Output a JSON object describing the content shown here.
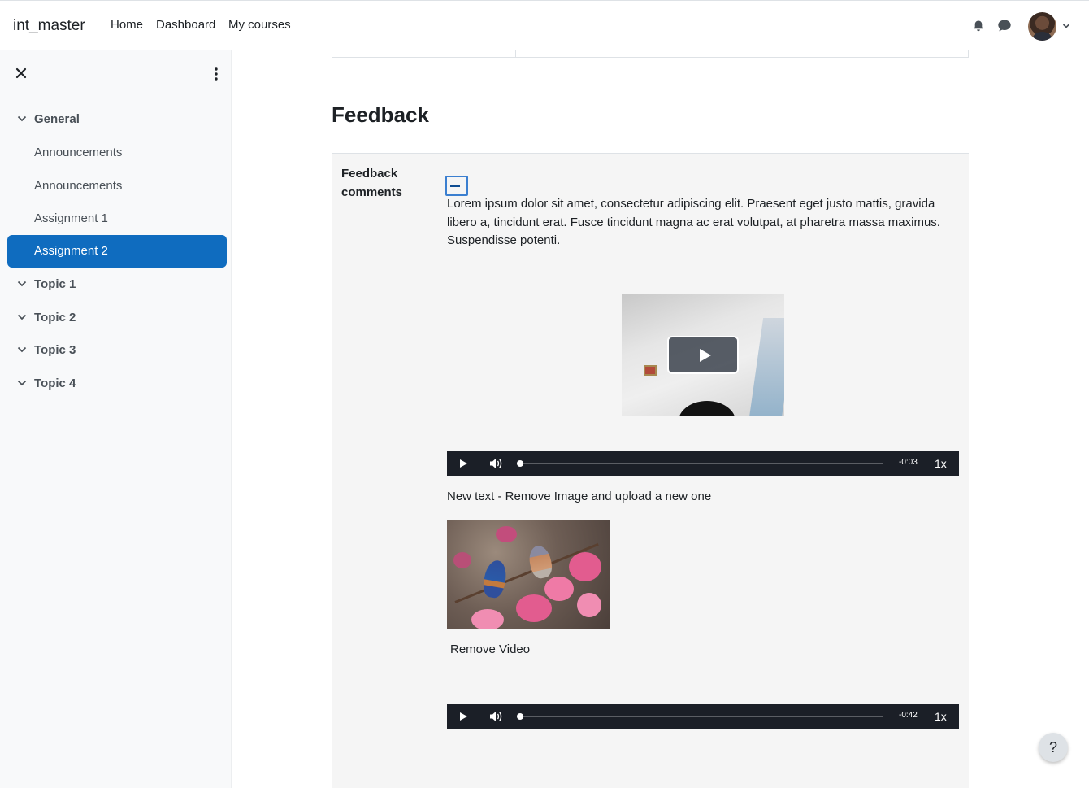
{
  "navbar": {
    "brand": "int_master",
    "links": [
      "Home",
      "Dashboard",
      "My courses"
    ]
  },
  "drawer": {
    "items": [
      {
        "label": "General",
        "type": "section",
        "expanded": true
      },
      {
        "label": "Announcements",
        "type": "activity"
      },
      {
        "label": "Announcements",
        "type": "activity"
      },
      {
        "label": "Assignment 1",
        "type": "activity"
      },
      {
        "label": "Assignment 2",
        "type": "activity",
        "active": true
      },
      {
        "label": "Topic 1",
        "type": "section",
        "expanded": true
      },
      {
        "label": "Topic 2",
        "type": "section",
        "expanded": true
      },
      {
        "label": "Topic 3",
        "type": "section",
        "expanded": true
      },
      {
        "label": "Topic 4",
        "type": "section",
        "expanded": true
      }
    ]
  },
  "main": {
    "heading": "Feedback",
    "feedback": {
      "label": "Feedback comments",
      "paragraph": "Lorem ipsum dolor sit amet, consectetur adipiscing elit. Praesent eget justo mattis, gravida libero a, tincidunt erat. Fusce tincidunt magna ac erat volutpat, at pharetra massa maximus. Suspendisse potenti.",
      "player1": {
        "time": "-0:03",
        "rate": "1x"
      },
      "new_text": "New text - Remove Image and upload a new one",
      "remove_video": "Remove Video",
      "player2": {
        "time": "-0:42",
        "rate": "1x"
      }
    }
  },
  "help": {
    "label": "?"
  },
  "colors": {
    "accent": "#0f6cbf",
    "drawer_bg": "#f8f9fa",
    "panel_bg": "#f5f5f5",
    "player_bg": "#1b1f27"
  },
  "icons": [
    "bell-icon",
    "chat-icon",
    "close-icon",
    "kebab-menu-icon",
    "chevron-down-icon",
    "play-icon",
    "volume-icon"
  ]
}
